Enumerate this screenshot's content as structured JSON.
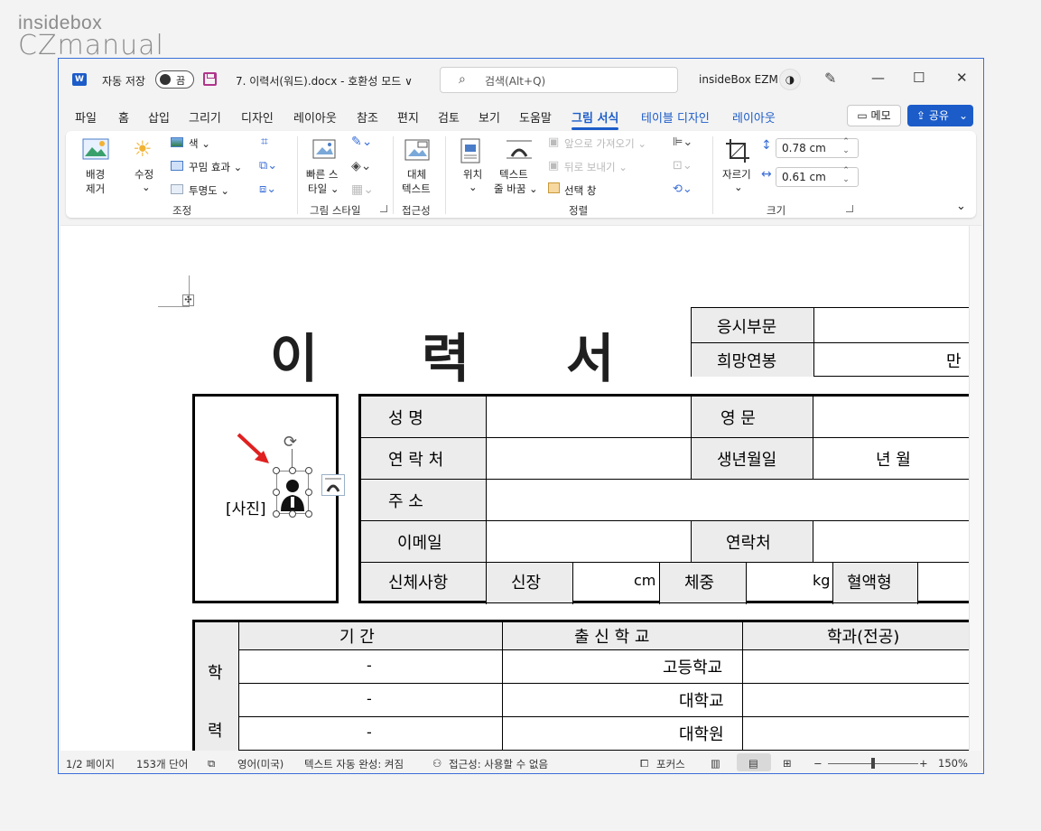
{
  "brand": {
    "line1": "insidebox",
    "line2": "CZmanual"
  },
  "titlebar": {
    "autosave_label": "자동 저장",
    "autosave_state": "끔",
    "document_name": "7. 이력서(워드).docx  -  호환성 모드 ∨",
    "search_placeholder": "검색(Alt+Q)",
    "account_name": "insideBox EZM",
    "minimize": "—",
    "maximize": "☐",
    "close": "✕"
  },
  "tabs": [
    {
      "label": "파일"
    },
    {
      "label": "홈"
    },
    {
      "label": "삽입"
    },
    {
      "label": "그리기"
    },
    {
      "label": "디자인"
    },
    {
      "label": "레이아웃"
    },
    {
      "label": "참조"
    },
    {
      "label": "편지"
    },
    {
      "label": "검토"
    },
    {
      "label": "보기"
    },
    {
      "label": "도움말"
    },
    {
      "label": "그림 서식"
    },
    {
      "label": "테이블 디자인"
    },
    {
      "label": "레이아웃"
    }
  ],
  "buttons": {
    "memo": "메모",
    "share": "공유"
  },
  "ribbon": {
    "remove_bg": [
      "배경",
      "제거"
    ],
    "corrections": "수정",
    "color": "색",
    "artistic": "꾸밈 효과",
    "transparency": "투명도",
    "group_adjust": "조정",
    "quick_styles": [
      "빠른 스",
      "타일"
    ],
    "group_styles": "그림 스타일",
    "alt_text": [
      "대체",
      "텍스트"
    ],
    "group_access": "접근성",
    "position": "위치",
    "wrap_text": [
      "텍스트",
      "줄 바꿈"
    ],
    "bring_forward": "앞으로 가져오기",
    "send_backward": "뒤로 보내기",
    "selection_pane": "선택 창",
    "group_arrange": "정렬",
    "crop": "자르기",
    "height": "0.78 cm",
    "width": "0.61 cm",
    "group_size": "크기"
  },
  "document": {
    "title_chars": [
      "이",
      "력",
      "서"
    ],
    "apply_dept": "응시부문",
    "desired_salary": "희망연봉",
    "salary_unit": "만",
    "photo": "[사진]",
    "name": "성     명",
    "eng_name": "영     문",
    "contact": "연 락 처",
    "birth": "생년월일",
    "birth_values": "년     월",
    "address": "주     소",
    "email": "이메일",
    "contact2": "연락처",
    "body": "신체사항",
    "height": "신장",
    "height_unit": "cm",
    "weight": "체중",
    "weight_unit": "kg",
    "blood": "혈액형",
    "edu_label1": "학",
    "edu_label2": "력",
    "period": "기     간",
    "school": "출 신 학 교",
    "major": "학과(전공)",
    "dash": "-",
    "high_school": "고등학교",
    "university": "대학교",
    "grad_school": "대학원"
  },
  "status": {
    "page": "1/2 페이지",
    "words": "153개 단어",
    "language": "영어(미국)",
    "autocomplete": "텍스트 자동 완성: 켜짐",
    "accessibility": "접근성: 사용할 수 없음",
    "focus": "포커스",
    "zoom": "150%"
  },
  "colors": {
    "accent": "#1c5cc9",
    "window_border": "#3b6fd8",
    "arrow": "#e02020"
  }
}
